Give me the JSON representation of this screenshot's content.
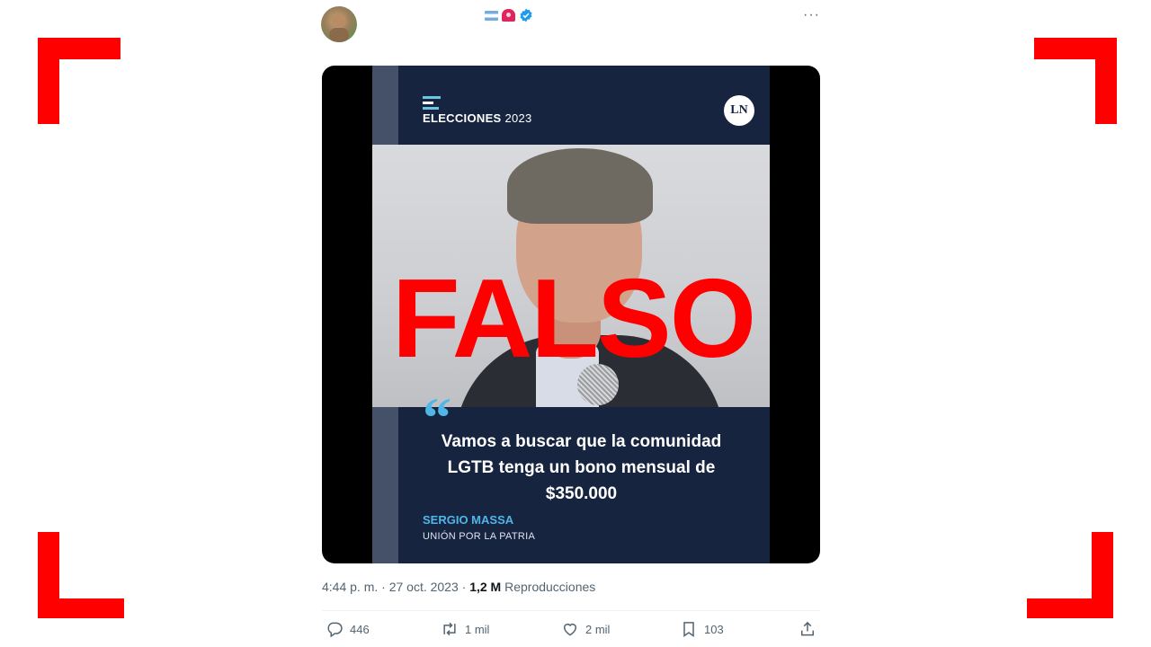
{
  "tweet": {
    "header": {
      "more_label": "···"
    },
    "media": {
      "kicker": "ELECCIONES",
      "kicker_year": "2023",
      "logo": "LN",
      "quote_mark": "“",
      "quote": "Vamos a buscar que la comunidad LGTB tenga un bono mensual de $350.000",
      "author": "SERGIO MASSA",
      "party": "UNIÓN POR LA PATRIA",
      "stamp": "FALSO"
    },
    "meta": {
      "timestamp": "4:44 p. m. · 27 oct. 2023 · ",
      "views_count": "1,2 M",
      "views_label": " Reproducciones"
    },
    "actions": {
      "replies": "446",
      "reposts": "1 mil",
      "likes": "2 mil",
      "bookmarks": "103"
    }
  },
  "colors": {
    "accent_red": "#ff0000",
    "post_background": "#17243f",
    "post_accent": "#4fb7e8",
    "muted_text": "#536471"
  },
  "icons": [
    "avatar",
    "argentina-flag-icon",
    "siren-icon",
    "verified-badge-icon",
    "more-icon",
    "reply-icon",
    "repost-icon",
    "like-icon",
    "bookmark-icon",
    "share-icon"
  ]
}
